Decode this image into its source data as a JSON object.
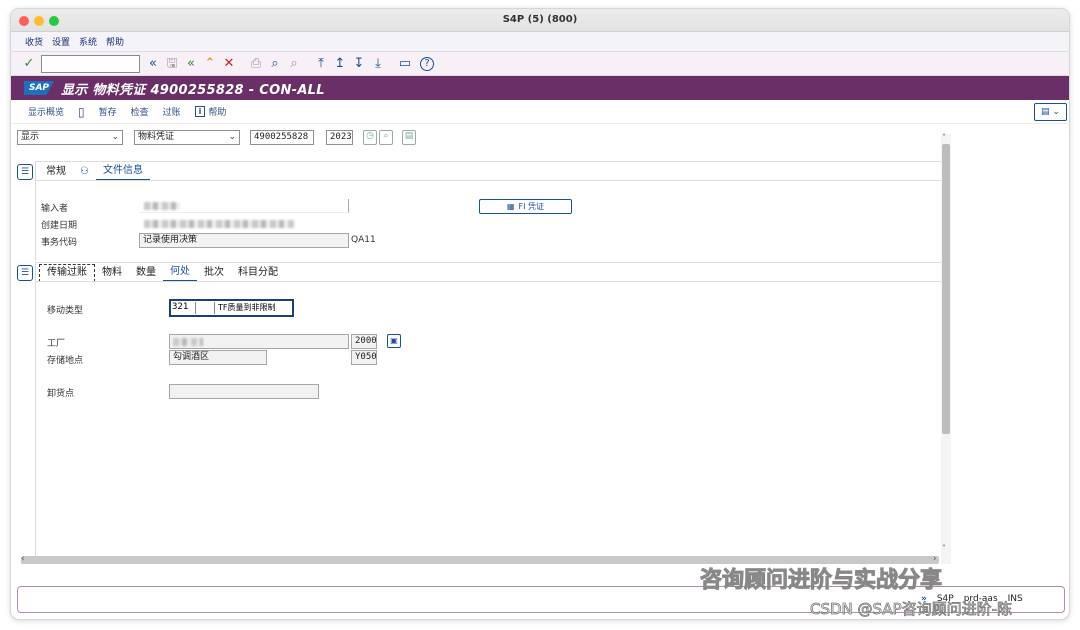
{
  "window": {
    "title": "S4P (5) (800)"
  },
  "menu": [
    "收货",
    "设置",
    "系统",
    "帮助"
  ],
  "header": {
    "title": "显示 物料凭证 4900255828 - CON-ALL",
    "logo": "SAP"
  },
  "app_toolbar": {
    "overview": "显示概览",
    "hold": "暂存",
    "check": "检查",
    "post": "过账",
    "help": "帮助"
  },
  "selection": {
    "action": "显示",
    "doc_type": "物料凭证",
    "doc_number": "4900255828",
    "year": "2023"
  },
  "header_tabs": [
    "常规",
    "文件信息"
  ],
  "doc_info": {
    "entered_by_label": "输入者",
    "created_on_label": "创建日期",
    "tcode_label": "事务代码",
    "tcode_text": "记录使用决策",
    "tcode_value": "QA11",
    "fi_button": "FI 凭证"
  },
  "item_tabs": [
    "传输过账",
    "物料",
    "数量",
    "何处",
    "批次",
    "科目分配"
  ],
  "where": {
    "movement_type_label": "移动类型",
    "movement_type": "321",
    "movement_desc": "TF质量到非限制",
    "plant_label": "工厂",
    "plant_code": "2000",
    "sloc_label": "存储地点",
    "sloc_name": "勾调酒区",
    "sloc_code": "Y050",
    "unloading_label": "卸货点"
  },
  "status": {
    "system": "S4P",
    "server": "prd-aas",
    "mode": "INS"
  },
  "watermark": {
    "line1": "咨询顾问进阶与实战分享",
    "line2": "CSDN @SAP咨询顾问进阶-陈"
  }
}
